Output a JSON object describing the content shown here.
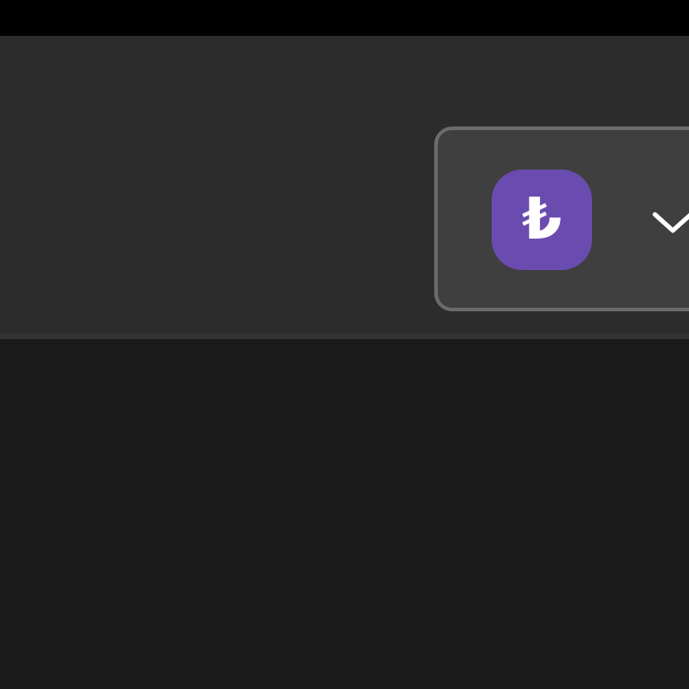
{
  "currency_selector": {
    "symbol": "₺",
    "icon": "chevron-down-icon",
    "badge_color": "#6a4cb0"
  },
  "colors": {
    "header_background": "#2c2c2c",
    "content_background": "#1a1a1a",
    "selector_background": "#3f3f3f",
    "selector_border": "#6b6b6b"
  }
}
